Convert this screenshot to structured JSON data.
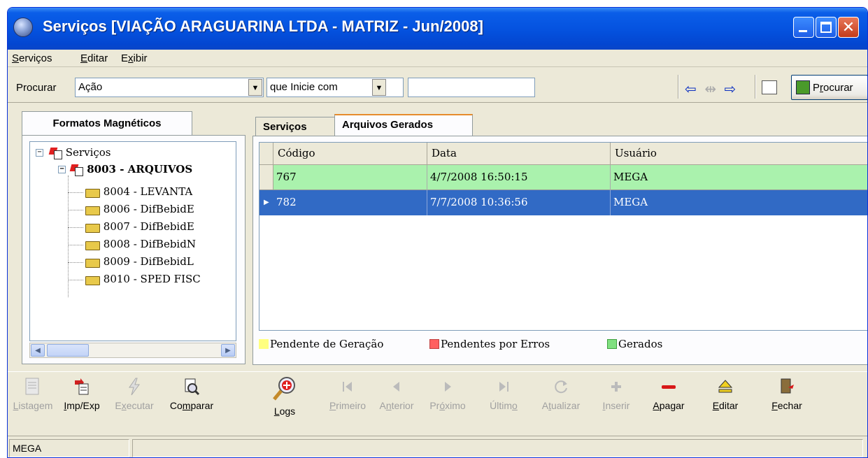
{
  "window": {
    "title": "Serviços [VIAÇÃO ARAGUARINA LTDA - MATRIZ - Jun/2008]"
  },
  "menu": [
    {
      "label_ul": "S",
      "label_rest": "erviços"
    },
    {
      "label_ul": "E",
      "label_rest": "ditar"
    },
    {
      "label_pre": "E",
      "label_ul": "x",
      "label_rest": "ibir"
    }
  ],
  "search": {
    "label": "Procurar",
    "field_value": "Ação",
    "mode_value": "que Inicie com",
    "text_value": "",
    "button_label_pre": "P",
    "button_label_ul": "r",
    "button_label_rest": "ocurar"
  },
  "left_panel": {
    "tab_label": "Formatos Magnéticos",
    "tree": {
      "root": "Serviços",
      "node": "8003 - ARQUIVOS",
      "children": [
        "8004 - LEVANTA",
        "8006 - DifBebidE",
        "8007 - DifBebidE",
        "8008 - DifBebidN",
        "8009 - DifBebidL",
        "8010 - SPED FISC"
      ]
    }
  },
  "right_panel": {
    "tabs": [
      "Serviços",
      "Arquivos Gerados"
    ],
    "active_tab": "Arquivos Gerados",
    "columns": [
      "Código",
      "Data",
      "Usuário"
    ],
    "rows": [
      {
        "codigo": "767",
        "data": "4/7/2008 16:50:15",
        "usuario": "MEGA",
        "status": "gerado"
      },
      {
        "codigo": "782",
        "data": "7/7/2008 10:36:56",
        "usuario": "MEGA",
        "status": "selected"
      }
    ],
    "legend": [
      {
        "label": "Pendente de Geração",
        "color": "#ffff80"
      },
      {
        "label": "Pendentes por Erros",
        "color": "#ff6060"
      },
      {
        "label": "Gerados",
        "color": "#80e080"
      }
    ]
  },
  "toolbar": [
    {
      "id": "listagem",
      "pre": "",
      "ul": "L",
      "rest": "istagem",
      "enabled": false,
      "icon": "report-icon"
    },
    {
      "id": "impexp",
      "pre": "",
      "ul": "I",
      "rest": "mp/Exp",
      "enabled": true,
      "icon": "import-export-icon"
    },
    {
      "id": "executar",
      "pre": "E",
      "ul": "x",
      "rest": "ecutar",
      "enabled": false,
      "icon": "lightning-icon"
    },
    {
      "id": "comparar",
      "pre": "Co",
      "ul": "m",
      "rest": "parar",
      "enabled": true,
      "icon": "compare-icon"
    },
    {
      "id": "logs",
      "pre": "",
      "ul": "L",
      "rest": "ogs",
      "enabled": true,
      "icon": "magnifier-plus-icon"
    },
    {
      "id": "primeiro",
      "pre": "",
      "ul": "P",
      "rest": "rimeiro",
      "enabled": false,
      "icon": "first-icon"
    },
    {
      "id": "anterior",
      "pre": "A",
      "ul": "n",
      "rest": "terior",
      "enabled": false,
      "icon": "previous-icon"
    },
    {
      "id": "proximo",
      "pre": "Pr",
      "ul": "ó",
      "rest": "ximo",
      "enabled": false,
      "icon": "next-icon"
    },
    {
      "id": "ultimo",
      "pre": "Últim",
      "ul": "o",
      "rest": "",
      "enabled": false,
      "icon": "last-icon"
    },
    {
      "id": "atualizar",
      "pre": "A",
      "ul": "t",
      "rest": "ualizar",
      "enabled": false,
      "icon": "refresh-icon"
    },
    {
      "id": "inserir",
      "pre": "",
      "ul": "I",
      "rest": "nserir",
      "enabled": false,
      "icon": "plus-icon"
    },
    {
      "id": "apagar",
      "pre": "",
      "ul": "A",
      "rest": "pagar",
      "enabled": true,
      "icon": "minus-icon"
    },
    {
      "id": "editar",
      "pre": "",
      "ul": "E",
      "rest": "ditar",
      "enabled": true,
      "icon": "eject-icon"
    },
    {
      "id": "fechar",
      "pre": "",
      "ul": "F",
      "rest": "echar",
      "enabled": true,
      "icon": "door-exit-icon"
    }
  ],
  "status": {
    "user": "MEGA"
  }
}
